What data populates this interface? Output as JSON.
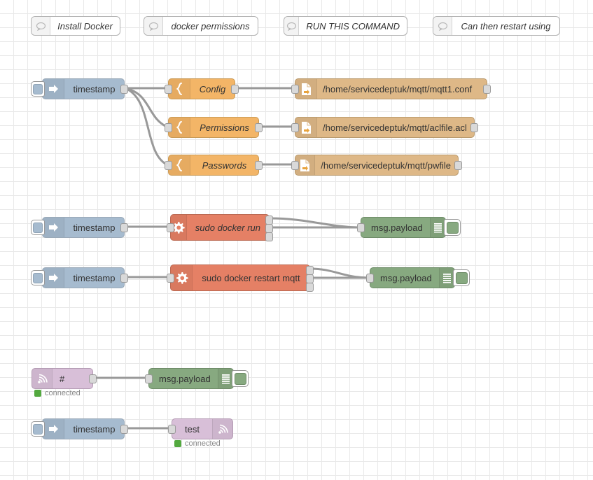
{
  "editor": {
    "title": "Node-RED flow canvas",
    "grid_color": "#e9e9e9",
    "background": "#ffffff",
    "wire_color": "#999999"
  },
  "palette": {
    "inject": "#a6bbcf",
    "template": "#f3b567",
    "file": "#deb887",
    "exec": "#e58065",
    "debug": "#87a980",
    "mqtt": "#d8bfd8",
    "comment": "#ffffff",
    "status_connected": "#53a93f"
  },
  "comments": [
    {
      "label": "Install Docker",
      "icon": "comment-icon"
    },
    {
      "label": "docker permissions",
      "icon": "comment-icon"
    },
    {
      "label": "RUN THIS COMMAND",
      "icon": "comment-icon"
    },
    {
      "label": "Can then restart using",
      "icon": "comment-icon"
    }
  ],
  "inject_nodes": [
    {
      "label": "timestamp",
      "icon": "inject-arrow-icon",
      "button": "inject-button"
    },
    {
      "label": "timestamp",
      "icon": "inject-arrow-icon",
      "button": "inject-button"
    },
    {
      "label": "timestamp",
      "icon": "inject-arrow-icon",
      "button": "inject-button"
    }
  ],
  "template_nodes": [
    {
      "label": "Config",
      "icon": "template-brace-icon"
    },
    {
      "label": "Permissions",
      "icon": "template-brace-icon"
    },
    {
      "label": "Passwords",
      "icon": "template-brace-icon"
    }
  ],
  "file_nodes": [
    {
      "label": "/home/servicedeptuk/mqtt/mqtt1.conf",
      "icon": "file-write-icon"
    },
    {
      "label": "/home/servicedeptuk/mqtt/aclfile.acl",
      "icon": "file-write-icon"
    },
    {
      "label": "/home/servicedeptuk/mqtt/pwfile",
      "icon": "file-write-icon"
    }
  ],
  "exec_nodes": [
    {
      "label": "sudo docker run",
      "icon": "gear-icon",
      "outputs": 3,
      "italic": true
    },
    {
      "label": "sudo docker restart mqtt",
      "icon": "gear-icon",
      "outputs": 3,
      "italic": false
    }
  ],
  "debug_nodes": [
    {
      "label": "msg.payload",
      "icon": "debug-lines-icon",
      "toggle": "debug-toggle-button"
    },
    {
      "label": "msg.payload",
      "icon": "debug-lines-icon",
      "toggle": "debug-toggle-button"
    },
    {
      "label": "msg.payload",
      "icon": "debug-lines-icon",
      "toggle": "debug-toggle-button"
    }
  ],
  "mqtt_nodes": [
    {
      "label": "#",
      "icon": "mqtt-wave-icon",
      "direction": "in",
      "status": "connected"
    },
    {
      "label": "test",
      "icon": "mqtt-wave-icon",
      "direction": "out",
      "status": "connected"
    }
  ]
}
